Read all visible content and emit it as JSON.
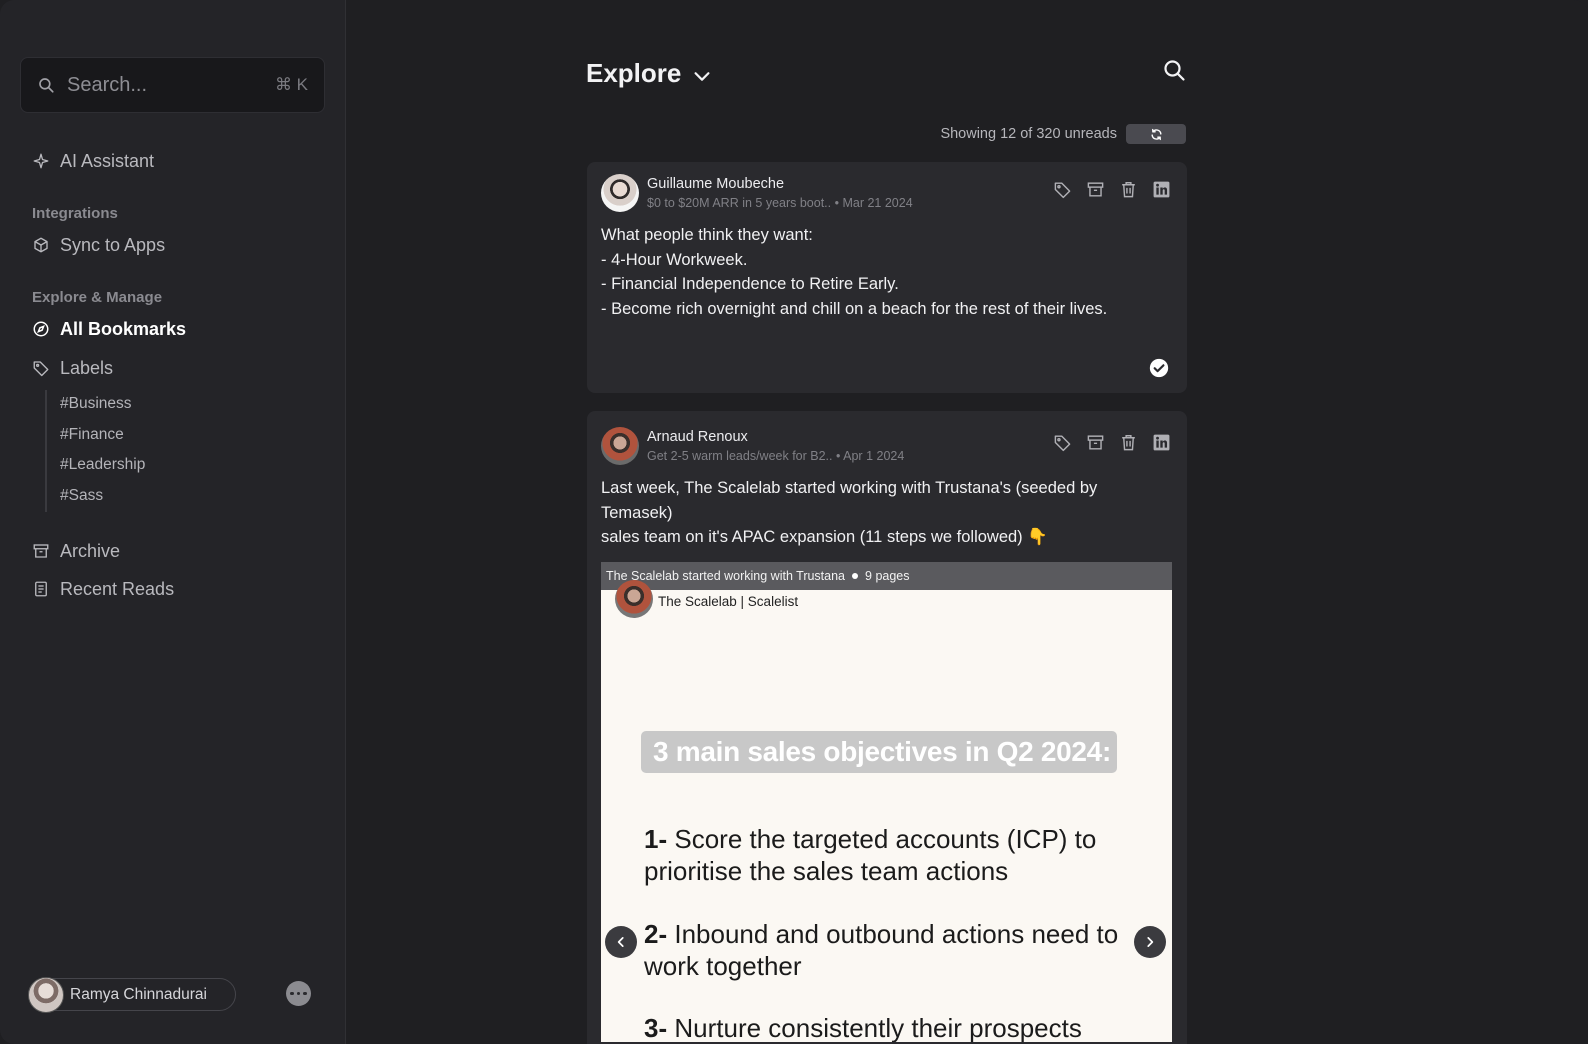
{
  "sidebar": {
    "search_placeholder": "Search...",
    "search_shortcut": "⌘ K",
    "ai_assistant": "AI Assistant",
    "integrations_label": "Integrations",
    "sync_to_apps": "Sync to Apps",
    "explore_manage_label": "Explore & Manage",
    "all_bookmarks": "All Bookmarks",
    "labels": "Labels",
    "label_items": [
      "#Business",
      "#Finance",
      "#Leadership",
      "#Sass"
    ],
    "archive": "Archive",
    "recent_reads": "Recent Reads",
    "user_name": "Ramya Chinnadurai"
  },
  "main": {
    "title": "Explore",
    "unread_status": "Showing 12 of 320 unreads"
  },
  "posts": [
    {
      "author": "Guillaume Moubeche",
      "subtitle": "$0 to $20M ARR in 5 years boot..",
      "date": "Mar 21 2024",
      "lines": [
        "What people think they want:",
        "- 4-Hour Workweek.",
        "- Financial Independence to Retire Early.",
        "- Become rich overnight and chill on a beach for the rest of their lives."
      ]
    },
    {
      "author": "Arnaud Renoux",
      "subtitle": "Get 2-5 warm leads/week for B2..",
      "date": "Apr 1 2024",
      "lines": [
        "Last week, The Scalelab started working with Trustana's (seeded by Temasek)",
        "sales team on it's APAC expansion (11 steps we followed) 👇"
      ],
      "document": {
        "title": "The Scalelab started working with Trustana",
        "pages": "9 pages",
        "brand": "The Scalelab | Scalelist",
        "heading": "3 main sales objectives in Q2 2024:",
        "points": [
          {
            "num": "1-",
            "text": "Score the targeted accounts (ICP) to prioritise the sales team actions"
          },
          {
            "num": "2-",
            "text": "Inbound and outbound actions need to work together"
          },
          {
            "num": "3-",
            "text": "Nurture consistently their prospects"
          }
        ]
      }
    }
  ],
  "colors": {
    "background": "#1f1f22",
    "sidebar": "#242428",
    "card": "#2a2a2e",
    "text_primary": "#f1f1f3"
  }
}
